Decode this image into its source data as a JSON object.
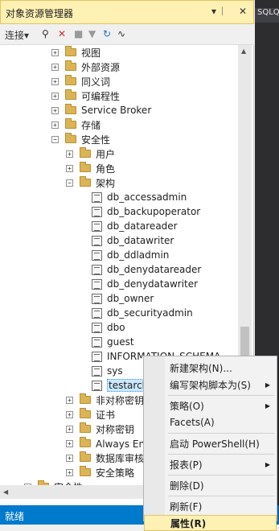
{
  "panel": {
    "title": "对象资源管理器",
    "pin": "▾ ᛁ",
    "close": "✕"
  },
  "toolbar": {
    "connect": "连接▾"
  },
  "right_tab": "SQLQ",
  "tree": [
    {
      "label": "视图",
      "level": 1,
      "icon": "folder",
      "expander": "+"
    },
    {
      "label": "外部资源",
      "level": 1,
      "icon": "folder",
      "expander": "+"
    },
    {
      "label": "同义词",
      "level": 1,
      "icon": "folder",
      "expander": "+"
    },
    {
      "label": "可编程性",
      "level": 1,
      "icon": "folder",
      "expander": "+"
    },
    {
      "label": "Service Broker",
      "level": 1,
      "icon": "folder",
      "expander": "+"
    },
    {
      "label": "存储",
      "level": 1,
      "icon": "folder",
      "expander": "+"
    },
    {
      "label": "安全性",
      "level": 1,
      "icon": "folder",
      "expander": "−"
    },
    {
      "label": "用户",
      "level": 2,
      "icon": "folder",
      "expander": "+"
    },
    {
      "label": "角色",
      "level": 2,
      "icon": "folder",
      "expander": "+"
    },
    {
      "label": "架构",
      "level": 2,
      "icon": "folder",
      "expander": "−"
    },
    {
      "label": "db_accessadmin",
      "level": 3,
      "icon": "schema"
    },
    {
      "label": "db_backupoperator",
      "level": 3,
      "icon": "schema"
    },
    {
      "label": "db_datareader",
      "level": 3,
      "icon": "schema"
    },
    {
      "label": "db_datawriter",
      "level": 3,
      "icon": "schema"
    },
    {
      "label": "db_ddladmin",
      "level": 3,
      "icon": "schema"
    },
    {
      "label": "db_denydatareader",
      "level": 3,
      "icon": "schema"
    },
    {
      "label": "db_denydatawriter",
      "level": 3,
      "icon": "schema"
    },
    {
      "label": "db_owner",
      "level": 3,
      "icon": "schema"
    },
    {
      "label": "db_securityadmin",
      "level": 3,
      "icon": "schema"
    },
    {
      "label": "dbo",
      "level": 3,
      "icon": "schema"
    },
    {
      "label": "guest",
      "level": 3,
      "icon": "schema"
    },
    {
      "label": "INFORMATION_SCHEMA",
      "level": 3,
      "icon": "schema"
    },
    {
      "label": "sys",
      "level": 3,
      "icon": "schema"
    },
    {
      "label": "testarchitecture",
      "level": 3,
      "icon": "schema",
      "selected": true
    },
    {
      "label": "非对称密钥",
      "level": 2,
      "icon": "folder",
      "expander": "+"
    },
    {
      "label": "证书",
      "level": 2,
      "icon": "folder",
      "expander": "+"
    },
    {
      "label": "对称密钥",
      "level": 2,
      "icon": "folder",
      "expander": "+"
    },
    {
      "label": "Always Encrypted 密钥",
      "level": 2,
      "icon": "folder",
      "expander": "+"
    },
    {
      "label": "数据库审核规范",
      "level": 2,
      "icon": "folder",
      "expander": "+"
    },
    {
      "label": "安全策略",
      "level": 2,
      "icon": "folder",
      "expander": "+"
    },
    {
      "label": "安全性",
      "level": 0,
      "icon": "folder",
      "expander": "+"
    }
  ],
  "context_menu": [
    {
      "label": "新建架构(N)...",
      "submenu": false
    },
    {
      "label": "编写架构脚本为(S)",
      "submenu": true
    },
    {
      "sep": true
    },
    {
      "label": "策略(O)",
      "submenu": true
    },
    {
      "label": "Facets(A)",
      "submenu": false
    },
    {
      "sep": true
    },
    {
      "label": "启动 PowerShell(H)",
      "submenu": false
    },
    {
      "sep": true
    },
    {
      "label": "报表(P)",
      "submenu": true
    },
    {
      "sep": true
    },
    {
      "label": "删除(D)",
      "submenu": false
    },
    {
      "sep": true
    },
    {
      "label": "刷新(F)",
      "submenu": false
    },
    {
      "label": "属性(R)",
      "submenu": false,
      "highlight": true
    }
  ],
  "status": "就绪"
}
